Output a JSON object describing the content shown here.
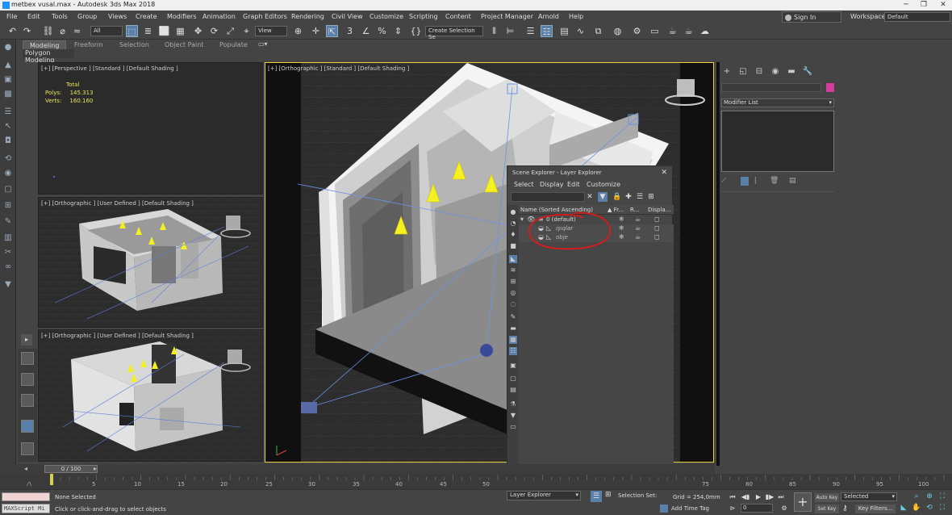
{
  "window": {
    "title": "metbex vusal.max - Autodesk 3ds Max 2018",
    "minimize": "─",
    "restore": "❐",
    "close": "✕"
  },
  "menubar": {
    "items": [
      "File",
      "Edit",
      "Tools",
      "Group",
      "Views",
      "Create",
      "Modifiers",
      "Animation",
      "Graph Editors",
      "Rendering",
      "Civil View",
      "Customize",
      "Scripting",
      "Content",
      "Project Manager",
      "Arnold",
      "Help"
    ],
    "signin": "Sign In",
    "workspaces_label": "Workspaces:",
    "workspaces_value": "Default"
  },
  "toolbar": {
    "filter_value": "All",
    "refcoord_value": "View",
    "named_selection_placeholder": "Create Selection Se"
  },
  "ribbon": {
    "tabs": [
      "Modeling",
      "Freeform",
      "Selection",
      "Object Paint",
      "Populate"
    ],
    "panel": "Polygon Modeling"
  },
  "viewports": {
    "perspective_label": "[+] [Perspective ] [Standard ] [Default Shading ]",
    "stats": {
      "total": "Total",
      "polys_label": "Polys:",
      "polys_value": "145.313",
      "verts_label": "Verts:",
      "verts_value": "160.160"
    },
    "ortho_main_label": "[+] [Orthographic ] [Standard ] [Default Shading ]",
    "ortho_user1_label": "[+] [Orthographic ] [User Defined ] [Default Shading ]",
    "ortho_user2_label": "[+] [Orthographic ] [User Defined ] [Default Shading ]"
  },
  "command_panel": {
    "modifier_list": "Modifier List"
  },
  "scene_explorer": {
    "title": "Scene Explorer - Layer Explorer",
    "menu": [
      "Select",
      "Display",
      "Edit",
      "Customize"
    ],
    "columns": {
      "name": "Name (Sorted Ascending)",
      "frozen": "▲ Fr...",
      "render": "R...",
      "display": "Displa..."
    },
    "rows": [
      {
        "name": "0 (default)"
      },
      {
        "name": "işıqlar"
      },
      {
        "name": "obje"
      }
    ]
  },
  "timeline": {
    "slider": "0 / 100",
    "ticks": [
      "5",
      "10",
      "15",
      "20",
      "25",
      "30",
      "35",
      "40",
      "45",
      "50",
      "75",
      "80",
      "85",
      "90",
      "95",
      "100"
    ]
  },
  "status": {
    "maxscript_label": "MAXScript Mi",
    "selected": "None Selected",
    "prompt": "Click or click-and-drag to select objects",
    "layer_explorer": "Layer Explorer",
    "selection_set": "Selection Set:",
    "grid": "Grid = 254,0mm",
    "add_time_tag": "Add Time Tag",
    "frame": "0",
    "auto_key": "Auto Key",
    "set_key": "Set Key",
    "selected_mode": "Selected",
    "key_filters": "Key Filters..."
  },
  "colors": {
    "accent": "#5a7fa8",
    "active_viewport": "#e6d13a",
    "annotation": "#d01e1e",
    "light_cone": "#f5f020"
  }
}
